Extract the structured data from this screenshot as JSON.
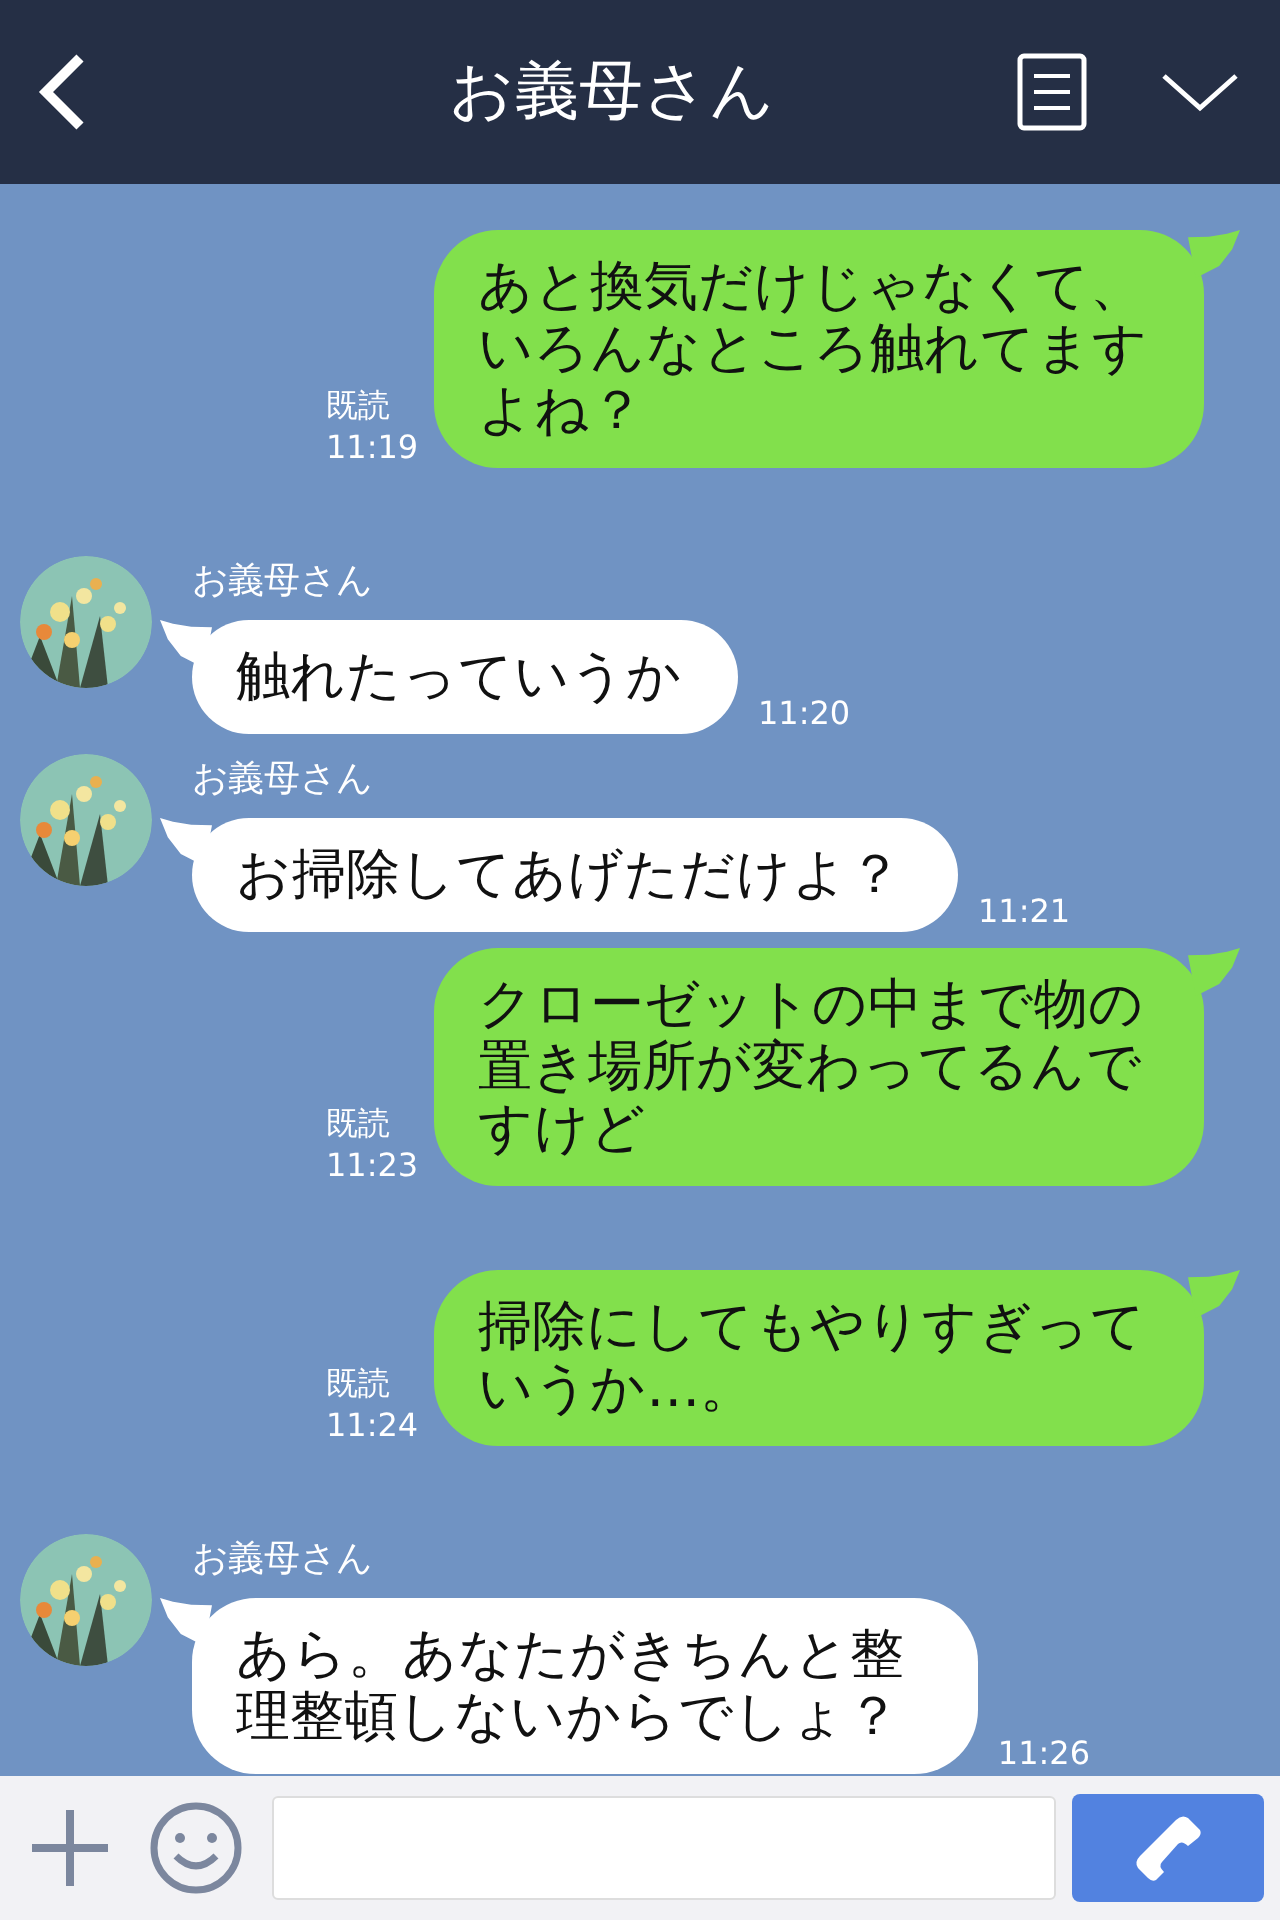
{
  "header": {
    "title": "お義母さん"
  },
  "messages": [
    {
      "kind": "sent",
      "text": "あと換気だけじゃなくて、いろんなところ触れてますよね？",
      "read": "既読",
      "time": "11:19"
    },
    {
      "kind": "received",
      "sender": "お義母さん",
      "text": "触れたっていうか",
      "time": "11:20"
    },
    {
      "kind": "received",
      "sender": "お義母さん",
      "text": "お掃除してあげただけよ？",
      "time": "11:21"
    },
    {
      "kind": "sent",
      "text": "クローゼットの中まで物の置き場所が変わってるんですけど",
      "read": "既読",
      "time": "11:23"
    },
    {
      "kind": "sent",
      "text": "掃除にしてもやりすぎっていうか…。",
      "read": "既読",
      "time": "11:24"
    },
    {
      "kind": "received",
      "sender": "お義母さん",
      "text": "あら。あなたがきちんと整理整頓しないからでしょ？",
      "time": "11:26"
    }
  ]
}
